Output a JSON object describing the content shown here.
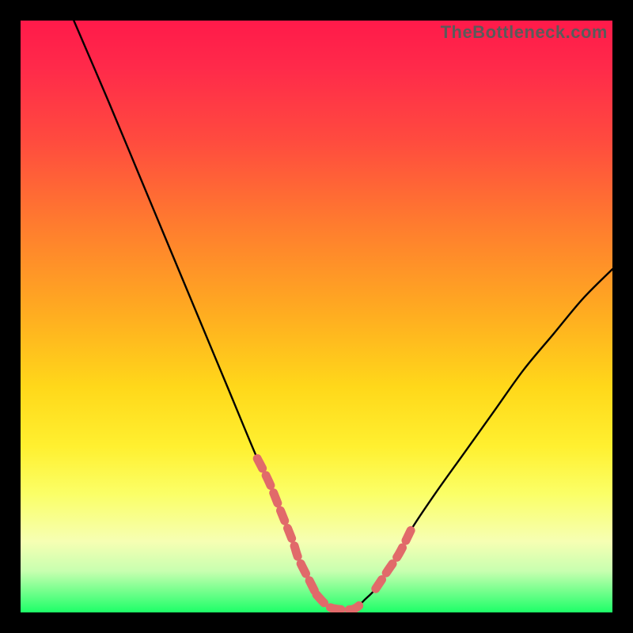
{
  "watermark": "TheBottleneck.com",
  "chart_data": {
    "type": "line",
    "title": "",
    "xlabel": "",
    "ylabel": "",
    "ylim": [
      0,
      100
    ],
    "xlim": [
      0,
      100
    ],
    "series": [
      {
        "name": "bottleneck-curve",
        "x": [
          9,
          15,
          20,
          25,
          30,
          35,
          40,
          42,
          44,
          46,
          47,
          49,
          50,
          52,
          54,
          56,
          57,
          58,
          60,
          62,
          64,
          66,
          70,
          75,
          80,
          85,
          90,
          95,
          100
        ],
        "values": [
          100,
          86,
          74,
          62,
          50,
          38,
          26,
          22,
          17,
          12,
          9,
          5,
          3,
          1,
          0.5,
          0.5,
          1,
          2,
          4,
          7,
          10,
          14,
          20,
          27,
          34,
          41,
          47,
          53,
          58
        ]
      },
      {
        "name": "highlight-band-left",
        "x": [
          40,
          42,
          44,
          46,
          47,
          49,
          50
        ],
        "values": [
          26,
          22,
          17,
          12,
          9,
          5,
          3
        ]
      },
      {
        "name": "highlight-band-bottom",
        "x": [
          50,
          52,
          54,
          56,
          57,
          58
        ],
        "values": [
          3,
          1,
          0.5,
          0.5,
          1,
          2
        ]
      },
      {
        "name": "highlight-band-right",
        "x": [
          60,
          62,
          64,
          66
        ],
        "values": [
          4,
          7,
          10,
          14
        ]
      }
    ],
    "colors": {
      "curve": "#000000",
      "highlight": "#e16a6a",
      "gradient_top": "#ff1a4a",
      "gradient_bottom": "#1dff68"
    }
  }
}
